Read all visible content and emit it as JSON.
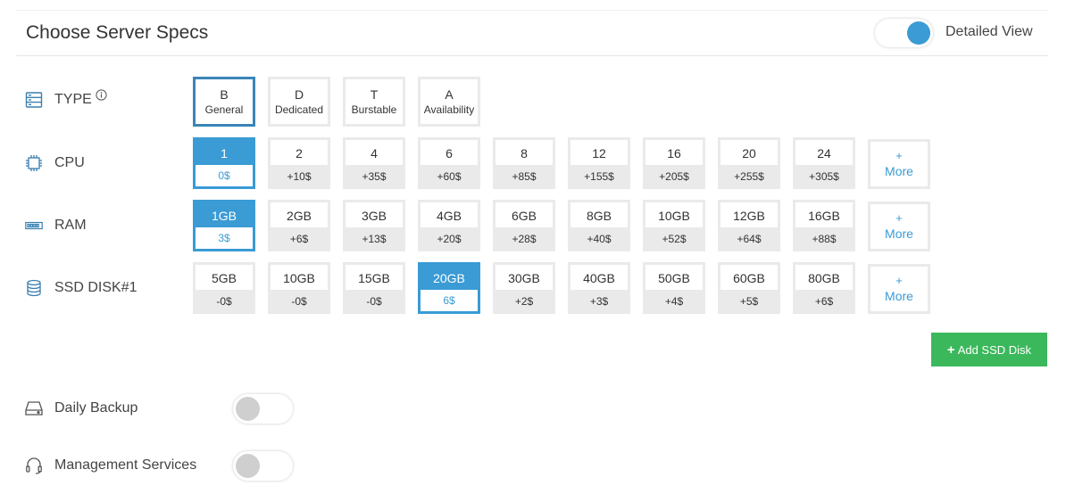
{
  "header": {
    "title": "Choose Server Specs",
    "detailed_view_label": "Detailed View",
    "detailed_view_on": true
  },
  "type": {
    "label": "TYPE",
    "icon": "server-rack-icon",
    "info_icon": "info-icon",
    "options": [
      {
        "letter": "B",
        "name": "General",
        "selected": true
      },
      {
        "letter": "D",
        "name": "Dedicated",
        "selected": false
      },
      {
        "letter": "T",
        "name": "Burstable",
        "selected": false
      },
      {
        "letter": "A",
        "name": "Availability",
        "selected": false
      }
    ]
  },
  "cpu": {
    "label": "CPU",
    "icon": "cpu-chip-icon",
    "options": [
      {
        "value": "1",
        "price": "0$",
        "selected": true
      },
      {
        "value": "2",
        "price": "+10$",
        "selected": false
      },
      {
        "value": "4",
        "price": "+35$",
        "selected": false
      },
      {
        "value": "6",
        "price": "+60$",
        "selected": false
      },
      {
        "value": "8",
        "price": "+85$",
        "selected": false
      },
      {
        "value": "12",
        "price": "+155$",
        "selected": false
      },
      {
        "value": "16",
        "price": "+205$",
        "selected": false
      },
      {
        "value": "20",
        "price": "+255$",
        "selected": false
      },
      {
        "value": "24",
        "price": "+305$",
        "selected": false
      }
    ],
    "more": {
      "plus": "+",
      "text": "More"
    }
  },
  "ram": {
    "label": "RAM",
    "icon": "memory-stick-icon",
    "options": [
      {
        "value": "1GB",
        "price": "3$",
        "selected": true
      },
      {
        "value": "2GB",
        "price": "+6$",
        "selected": false
      },
      {
        "value": "3GB",
        "price": "+13$",
        "selected": false
      },
      {
        "value": "4GB",
        "price": "+20$",
        "selected": false
      },
      {
        "value": "6GB",
        "price": "+28$",
        "selected": false
      },
      {
        "value": "8GB",
        "price": "+40$",
        "selected": false
      },
      {
        "value": "10GB",
        "price": "+52$",
        "selected": false
      },
      {
        "value": "12GB",
        "price": "+64$",
        "selected": false
      },
      {
        "value": "16GB",
        "price": "+88$",
        "selected": false
      }
    ],
    "more": {
      "plus": "+",
      "text": "More"
    }
  },
  "ssd": {
    "label": "SSD DISK#1",
    "icon": "database-icon",
    "options": [
      {
        "value": "5GB",
        "price": "-0$",
        "selected": false
      },
      {
        "value": "10GB",
        "price": "-0$",
        "selected": false
      },
      {
        "value": "15GB",
        "price": "-0$",
        "selected": false
      },
      {
        "value": "20GB",
        "price": "6$",
        "selected": true
      },
      {
        "value": "30GB",
        "price": "+2$",
        "selected": false
      },
      {
        "value": "40GB",
        "price": "+3$",
        "selected": false
      },
      {
        "value": "50GB",
        "price": "+4$",
        "selected": false
      },
      {
        "value": "60GB",
        "price": "+5$",
        "selected": false
      },
      {
        "value": "80GB",
        "price": "+6$",
        "selected": false
      }
    ],
    "more": {
      "plus": "+",
      "text": "More"
    },
    "add_button_label": "Add SSD Disk"
  },
  "daily_backup": {
    "label": "Daily Backup",
    "icon": "hard-drive-icon",
    "enabled": false
  },
  "management": {
    "label": "Management Services",
    "icon": "headset-icon",
    "enabled": false
  },
  "colors": {
    "accent": "#3a9bd5",
    "success": "#3cb85c",
    "tile_border": "#eaeaea",
    "switch_off_knob": "#cfcfcf"
  }
}
